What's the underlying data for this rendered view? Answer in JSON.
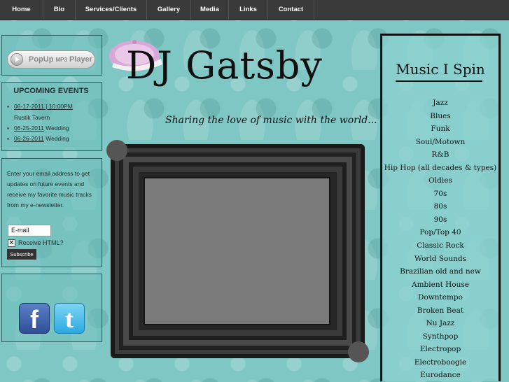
{
  "nav": [
    "Home",
    "Bio",
    "Services/Clients",
    "Gallery",
    "Media",
    "Links",
    "Contact"
  ],
  "player": {
    "label_main": "PopUp",
    "label_small": "MP3",
    "label_end": "Player"
  },
  "events": {
    "title": "UPCOMING EVENTS",
    "items": [
      {
        "date": "06-17-2011 | 10:00PM",
        "name": "Rustik Tavern"
      },
      {
        "date": "06-25-2011",
        "name": "Wedding"
      },
      {
        "date": "06-26-2011",
        "name": "Wedding"
      }
    ]
  },
  "newsletter": {
    "text": "Enter your email address to get updates on future events and receive my favorite music tracks from my e-newsletter.",
    "email_value": "E-mail",
    "html_label": "Receive HTML?",
    "subscribe": "Subscribe"
  },
  "social": {
    "facebook": "f",
    "twitter": "t"
  },
  "header": {
    "title": "DJ Gatsby",
    "tagline": "Sharing the love of music with the world..."
  },
  "music": {
    "title": "Music I Spin",
    "genres": [
      "Jazz",
      "Blues",
      "Funk",
      "Soul/Motown",
      "R&B",
      "Hip Hop (all decades & types)",
      "Oldies",
      "70s",
      "80s",
      "90s",
      "Pop/Top 40",
      "Classic Rock",
      "World Sounds",
      "Brazilian old and new",
      "Ambient House",
      "Downtempo",
      "Broken Beat",
      "Nu Jazz",
      "Synthpop",
      "Electropop",
      "Electroboogie",
      "Eurodance"
    ]
  },
  "colors": {
    "background": "#7fc7c4",
    "nav": "#3a3a3a",
    "text": "#101010"
  }
}
